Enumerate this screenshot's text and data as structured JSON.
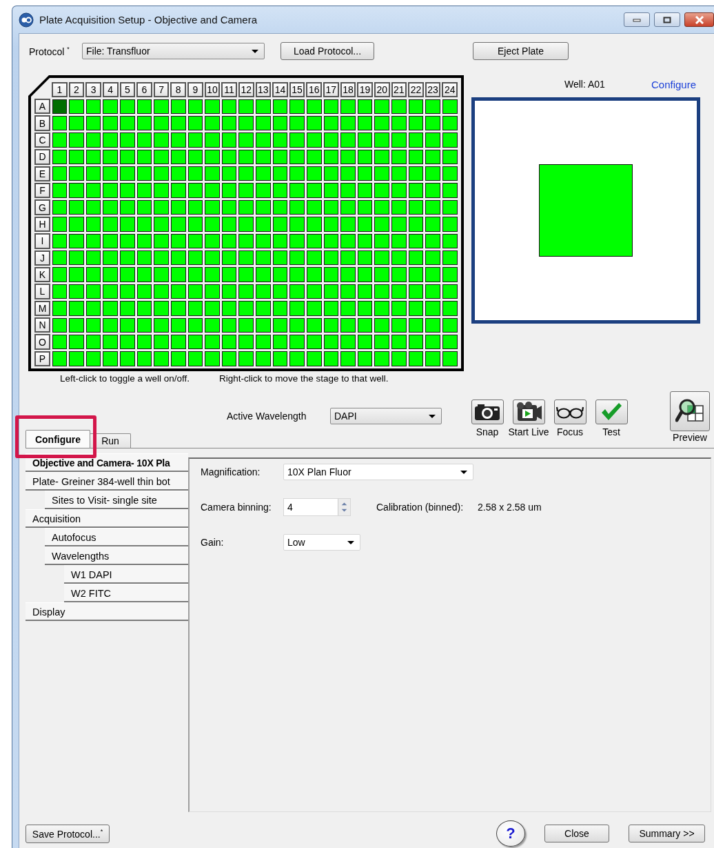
{
  "window": {
    "title": "Plate Acquisition Setup - Objective and Camera"
  },
  "protocol": {
    "label": "Protocol $^{*}$",
    "value": "File: Transfluor"
  },
  "top_buttons": [
    {
      "kind": "load",
      "label": "Load Protocol..."
    },
    {
      "kind": "eject",
      "label": "Eject Plate"
    }
  ],
  "plate": {
    "columns": [
      "1",
      "2",
      "3",
      "4",
      "5",
      "6",
      "7",
      "8",
      "9",
      "10",
      "11",
      "12",
      "13",
      "14",
      "15",
      "16",
      "17",
      "18",
      "19",
      "20",
      "21",
      "22",
      "23",
      "24"
    ],
    "rows": [
      {
        "label": "A",
        "wells": [
          {
            "selected": true
          },
          {
            "selected": false
          },
          {
            "selected": false
          },
          {
            "selected": false
          },
          {
            "selected": false
          },
          {
            "selected": false
          },
          {
            "selected": false
          },
          {
            "selected": false
          },
          {
            "selected": false
          },
          {
            "selected": false
          },
          {
            "selected": false
          },
          {
            "selected": false
          },
          {
            "selected": false
          },
          {
            "selected": false
          },
          {
            "selected": false
          },
          {
            "selected": false
          },
          {
            "selected": false
          },
          {
            "selected": false
          },
          {
            "selected": false
          },
          {
            "selected": false
          },
          {
            "selected": false
          },
          {
            "selected": false
          },
          {
            "selected": false
          },
          {
            "selected": false
          }
        ]
      },
      {
        "label": "B",
        "wells": [
          {
            "selected": false
          },
          {
            "selected": false
          },
          {
            "selected": false
          },
          {
            "selected": false
          },
          {
            "selected": false
          },
          {
            "selected": false
          },
          {
            "selected": false
          },
          {
            "selected": false
          },
          {
            "selected": false
          },
          {
            "selected": false
          },
          {
            "selected": false
          },
          {
            "selected": false
          },
          {
            "selected": false
          },
          {
            "selected": false
          },
          {
            "selected": false
          },
          {
            "selected": false
          },
          {
            "selected": false
          },
          {
            "selected": false
          },
          {
            "selected": false
          },
          {
            "selected": false
          },
          {
            "selected": false
          },
          {
            "selected": false
          },
          {
            "selected": false
          },
          {
            "selected": false
          }
        ]
      },
      {
        "label": "C",
        "wells": [
          {
            "selected": false
          },
          {
            "selected": false
          },
          {
            "selected": false
          },
          {
            "selected": false
          },
          {
            "selected": false
          },
          {
            "selected": false
          },
          {
            "selected": false
          },
          {
            "selected": false
          },
          {
            "selected": false
          },
          {
            "selected": false
          },
          {
            "selected": false
          },
          {
            "selected": false
          },
          {
            "selected": false
          },
          {
            "selected": false
          },
          {
            "selected": false
          },
          {
            "selected": false
          },
          {
            "selected": false
          },
          {
            "selected": false
          },
          {
            "selected": false
          },
          {
            "selected": false
          },
          {
            "selected": false
          },
          {
            "selected": false
          },
          {
            "selected": false
          },
          {
            "selected": false
          }
        ]
      },
      {
        "label": "D",
        "wells": [
          {
            "selected": false
          },
          {
            "selected": false
          },
          {
            "selected": false
          },
          {
            "selected": false
          },
          {
            "selected": false
          },
          {
            "selected": false
          },
          {
            "selected": false
          },
          {
            "selected": false
          },
          {
            "selected": false
          },
          {
            "selected": false
          },
          {
            "selected": false
          },
          {
            "selected": false
          },
          {
            "selected": false
          },
          {
            "selected": false
          },
          {
            "selected": false
          },
          {
            "selected": false
          },
          {
            "selected": false
          },
          {
            "selected": false
          },
          {
            "selected": false
          },
          {
            "selected": false
          },
          {
            "selected": false
          },
          {
            "selected": false
          },
          {
            "selected": false
          },
          {
            "selected": false
          }
        ]
      },
      {
        "label": "E",
        "wells": [
          {
            "selected": false
          },
          {
            "selected": false
          },
          {
            "selected": false
          },
          {
            "selected": false
          },
          {
            "selected": false
          },
          {
            "selected": false
          },
          {
            "selected": false
          },
          {
            "selected": false
          },
          {
            "selected": false
          },
          {
            "selected": false
          },
          {
            "selected": false
          },
          {
            "selected": false
          },
          {
            "selected": false
          },
          {
            "selected": false
          },
          {
            "selected": false
          },
          {
            "selected": false
          },
          {
            "selected": false
          },
          {
            "selected": false
          },
          {
            "selected": false
          },
          {
            "selected": false
          },
          {
            "selected": false
          },
          {
            "selected": false
          },
          {
            "selected": false
          },
          {
            "selected": false
          }
        ]
      },
      {
        "label": "F",
        "wells": [
          {
            "selected": false
          },
          {
            "selected": false
          },
          {
            "selected": false
          },
          {
            "selected": false
          },
          {
            "selected": false
          },
          {
            "selected": false
          },
          {
            "selected": false
          },
          {
            "selected": false
          },
          {
            "selected": false
          },
          {
            "selected": false
          },
          {
            "selected": false
          },
          {
            "selected": false
          },
          {
            "selected": false
          },
          {
            "selected": false
          },
          {
            "selected": false
          },
          {
            "selected": false
          },
          {
            "selected": false
          },
          {
            "selected": false
          },
          {
            "selected": false
          },
          {
            "selected": false
          },
          {
            "selected": false
          },
          {
            "selected": false
          },
          {
            "selected": false
          },
          {
            "selected": false
          }
        ]
      },
      {
        "label": "G",
        "wells": [
          {
            "selected": false
          },
          {
            "selected": false
          },
          {
            "selected": false
          },
          {
            "selected": false
          },
          {
            "selected": false
          },
          {
            "selected": false
          },
          {
            "selected": false
          },
          {
            "selected": false
          },
          {
            "selected": false
          },
          {
            "selected": false
          },
          {
            "selected": false
          },
          {
            "selected": false
          },
          {
            "selected": false
          },
          {
            "selected": false
          },
          {
            "selected": false
          },
          {
            "selected": false
          },
          {
            "selected": false
          },
          {
            "selected": false
          },
          {
            "selected": false
          },
          {
            "selected": false
          },
          {
            "selected": false
          },
          {
            "selected": false
          },
          {
            "selected": false
          },
          {
            "selected": false
          }
        ]
      },
      {
        "label": "H",
        "wells": [
          {
            "selected": false
          },
          {
            "selected": false
          },
          {
            "selected": false
          },
          {
            "selected": false
          },
          {
            "selected": false
          },
          {
            "selected": false
          },
          {
            "selected": false
          },
          {
            "selected": false
          },
          {
            "selected": false
          },
          {
            "selected": false
          },
          {
            "selected": false
          },
          {
            "selected": false
          },
          {
            "selected": false
          },
          {
            "selected": false
          },
          {
            "selected": false
          },
          {
            "selected": false
          },
          {
            "selected": false
          },
          {
            "selected": false
          },
          {
            "selected": false
          },
          {
            "selected": false
          },
          {
            "selected": false
          },
          {
            "selected": false
          },
          {
            "selected": false
          },
          {
            "selected": false
          }
        ]
      },
      {
        "label": "I",
        "wells": [
          {
            "selected": false
          },
          {
            "selected": false
          },
          {
            "selected": false
          },
          {
            "selected": false
          },
          {
            "selected": false
          },
          {
            "selected": false
          },
          {
            "selected": false
          },
          {
            "selected": false
          },
          {
            "selected": false
          },
          {
            "selected": false
          },
          {
            "selected": false
          },
          {
            "selected": false
          },
          {
            "selected": false
          },
          {
            "selected": false
          },
          {
            "selected": false
          },
          {
            "selected": false
          },
          {
            "selected": false
          },
          {
            "selected": false
          },
          {
            "selected": false
          },
          {
            "selected": false
          },
          {
            "selected": false
          },
          {
            "selected": false
          },
          {
            "selected": false
          },
          {
            "selected": false
          }
        ]
      },
      {
        "label": "J",
        "wells": [
          {
            "selected": false
          },
          {
            "selected": false
          },
          {
            "selected": false
          },
          {
            "selected": false
          },
          {
            "selected": false
          },
          {
            "selected": false
          },
          {
            "selected": false
          },
          {
            "selected": false
          },
          {
            "selected": false
          },
          {
            "selected": false
          },
          {
            "selected": false
          },
          {
            "selected": false
          },
          {
            "selected": false
          },
          {
            "selected": false
          },
          {
            "selected": false
          },
          {
            "selected": false
          },
          {
            "selected": false
          },
          {
            "selected": false
          },
          {
            "selected": false
          },
          {
            "selected": false
          },
          {
            "selected": false
          },
          {
            "selected": false
          },
          {
            "selected": false
          },
          {
            "selected": false
          }
        ]
      },
      {
        "label": "K",
        "wells": [
          {
            "selected": false
          },
          {
            "selected": false
          },
          {
            "selected": false
          },
          {
            "selected": false
          },
          {
            "selected": false
          },
          {
            "selected": false
          },
          {
            "selected": false
          },
          {
            "selected": false
          },
          {
            "selected": false
          },
          {
            "selected": false
          },
          {
            "selected": false
          },
          {
            "selected": false
          },
          {
            "selected": false
          },
          {
            "selected": false
          },
          {
            "selected": false
          },
          {
            "selected": false
          },
          {
            "selected": false
          },
          {
            "selected": false
          },
          {
            "selected": false
          },
          {
            "selected": false
          },
          {
            "selected": false
          },
          {
            "selected": false
          },
          {
            "selected": false
          },
          {
            "selected": false
          }
        ]
      },
      {
        "label": "L",
        "wells": [
          {
            "selected": false
          },
          {
            "selected": false
          },
          {
            "selected": false
          },
          {
            "selected": false
          },
          {
            "selected": false
          },
          {
            "selected": false
          },
          {
            "selected": false
          },
          {
            "selected": false
          },
          {
            "selected": false
          },
          {
            "selected": false
          },
          {
            "selected": false
          },
          {
            "selected": false
          },
          {
            "selected": false
          },
          {
            "selected": false
          },
          {
            "selected": false
          },
          {
            "selected": false
          },
          {
            "selected": false
          },
          {
            "selected": false
          },
          {
            "selected": false
          },
          {
            "selected": false
          },
          {
            "selected": false
          },
          {
            "selected": false
          },
          {
            "selected": false
          },
          {
            "selected": false
          }
        ]
      },
      {
        "label": "M",
        "wells": [
          {
            "selected": false
          },
          {
            "selected": false
          },
          {
            "selected": false
          },
          {
            "selected": false
          },
          {
            "selected": false
          },
          {
            "selected": false
          },
          {
            "selected": false
          },
          {
            "selected": false
          },
          {
            "selected": false
          },
          {
            "selected": false
          },
          {
            "selected": false
          },
          {
            "selected": false
          },
          {
            "selected": false
          },
          {
            "selected": false
          },
          {
            "selected": false
          },
          {
            "selected": false
          },
          {
            "selected": false
          },
          {
            "selected": false
          },
          {
            "selected": false
          },
          {
            "selected": false
          },
          {
            "selected": false
          },
          {
            "selected": false
          },
          {
            "selected": false
          },
          {
            "selected": false
          }
        ]
      },
      {
        "label": "N",
        "wells": [
          {
            "selected": false
          },
          {
            "selected": false
          },
          {
            "selected": false
          },
          {
            "selected": false
          },
          {
            "selected": false
          },
          {
            "selected": false
          },
          {
            "selected": false
          },
          {
            "selected": false
          },
          {
            "selected": false
          },
          {
            "selected": false
          },
          {
            "selected": false
          },
          {
            "selected": false
          },
          {
            "selected": false
          },
          {
            "selected": false
          },
          {
            "selected": false
          },
          {
            "selected": false
          },
          {
            "selected": false
          },
          {
            "selected": false
          },
          {
            "selected": false
          },
          {
            "selected": false
          },
          {
            "selected": false
          },
          {
            "selected": false
          },
          {
            "selected": false
          },
          {
            "selected": false
          }
        ]
      },
      {
        "label": "O",
        "wells": [
          {
            "selected": false
          },
          {
            "selected": false
          },
          {
            "selected": false
          },
          {
            "selected": false
          },
          {
            "selected": false
          },
          {
            "selected": false
          },
          {
            "selected": false
          },
          {
            "selected": false
          },
          {
            "selected": false
          },
          {
            "selected": false
          },
          {
            "selected": false
          },
          {
            "selected": false
          },
          {
            "selected": false
          },
          {
            "selected": false
          },
          {
            "selected": false
          },
          {
            "selected": false
          },
          {
            "selected": false
          },
          {
            "selected": false
          },
          {
            "selected": false
          },
          {
            "selected": false
          },
          {
            "selected": false
          },
          {
            "selected": false
          },
          {
            "selected": false
          },
          {
            "selected": false
          }
        ]
      },
      {
        "label": "P",
        "wells": [
          {
            "selected": false
          },
          {
            "selected": false
          },
          {
            "selected": false
          },
          {
            "selected": false
          },
          {
            "selected": false
          },
          {
            "selected": false
          },
          {
            "selected": false
          },
          {
            "selected": false
          },
          {
            "selected": false
          },
          {
            "selected": false
          },
          {
            "selected": false
          },
          {
            "selected": false
          },
          {
            "selected": false
          },
          {
            "selected": false
          },
          {
            "selected": false
          },
          {
            "selected": false
          },
          {
            "selected": false
          },
          {
            "selected": false
          },
          {
            "selected": false
          },
          {
            "selected": false
          },
          {
            "selected": false
          },
          {
            "selected": false
          },
          {
            "selected": false
          },
          {
            "selected": false
          }
        ]
      }
    ],
    "hints": [
      "Left-click to toggle a well on/off.",
      "Right-click to move the stage to that well."
    ]
  },
  "preview": {
    "well_label": "Well: A01",
    "configure_link": "Configure"
  },
  "active_wavelength": {
    "label": "Active Wavelength",
    "value": "DAPI"
  },
  "tools": [
    {
      "kind": "snap",
      "label": "Snap"
    },
    {
      "kind": "live",
      "label": "Start Live"
    },
    {
      "kind": "focus",
      "label": "Focus"
    },
    {
      "kind": "test",
      "label": "Test"
    },
    {
      "kind": "preview",
      "label": "Preview"
    }
  ],
  "tabs": [
    {
      "label": "Configure",
      "selected": true
    },
    {
      "label": "Run",
      "selected": false
    }
  ],
  "tree": [
    {
      "label": "Objective and Camera- 10X Pla",
      "selected": true
    },
    {
      "label": "Plate- Greiner 384-well thin bot",
      "selected": false,
      "children": [
        {
          "label": "Sites to Visit- single site",
          "selected": false
        }
      ]
    },
    {
      "label": "Acquisition",
      "selected": false,
      "children": [
        {
          "label": "Autofocus",
          "selected": false
        },
        {
          "label": "Wavelengths",
          "selected": false,
          "children": [
            {
              "label": "W1 DAPI",
              "selected": false
            },
            {
              "label": "W2 FITC",
              "selected": false
            }
          ]
        }
      ]
    },
    {
      "label": "Display",
      "selected": false
    }
  ],
  "form": {
    "magnification": {
      "label": "Magnification:",
      "value": "10X Plan Fluor"
    },
    "binning": {
      "label": "Camera binning:",
      "value": "4"
    },
    "calibration": {
      "label": "Calibration (binned):",
      "value": "2.58 x 2.58 um"
    },
    "gain": {
      "label": "Gain:",
      "value": "Low"
    }
  },
  "footer": {
    "save": "Save Protocol...$^{*}$",
    "help": "?",
    "close": "Close",
    "summary": "Summary >>"
  }
}
